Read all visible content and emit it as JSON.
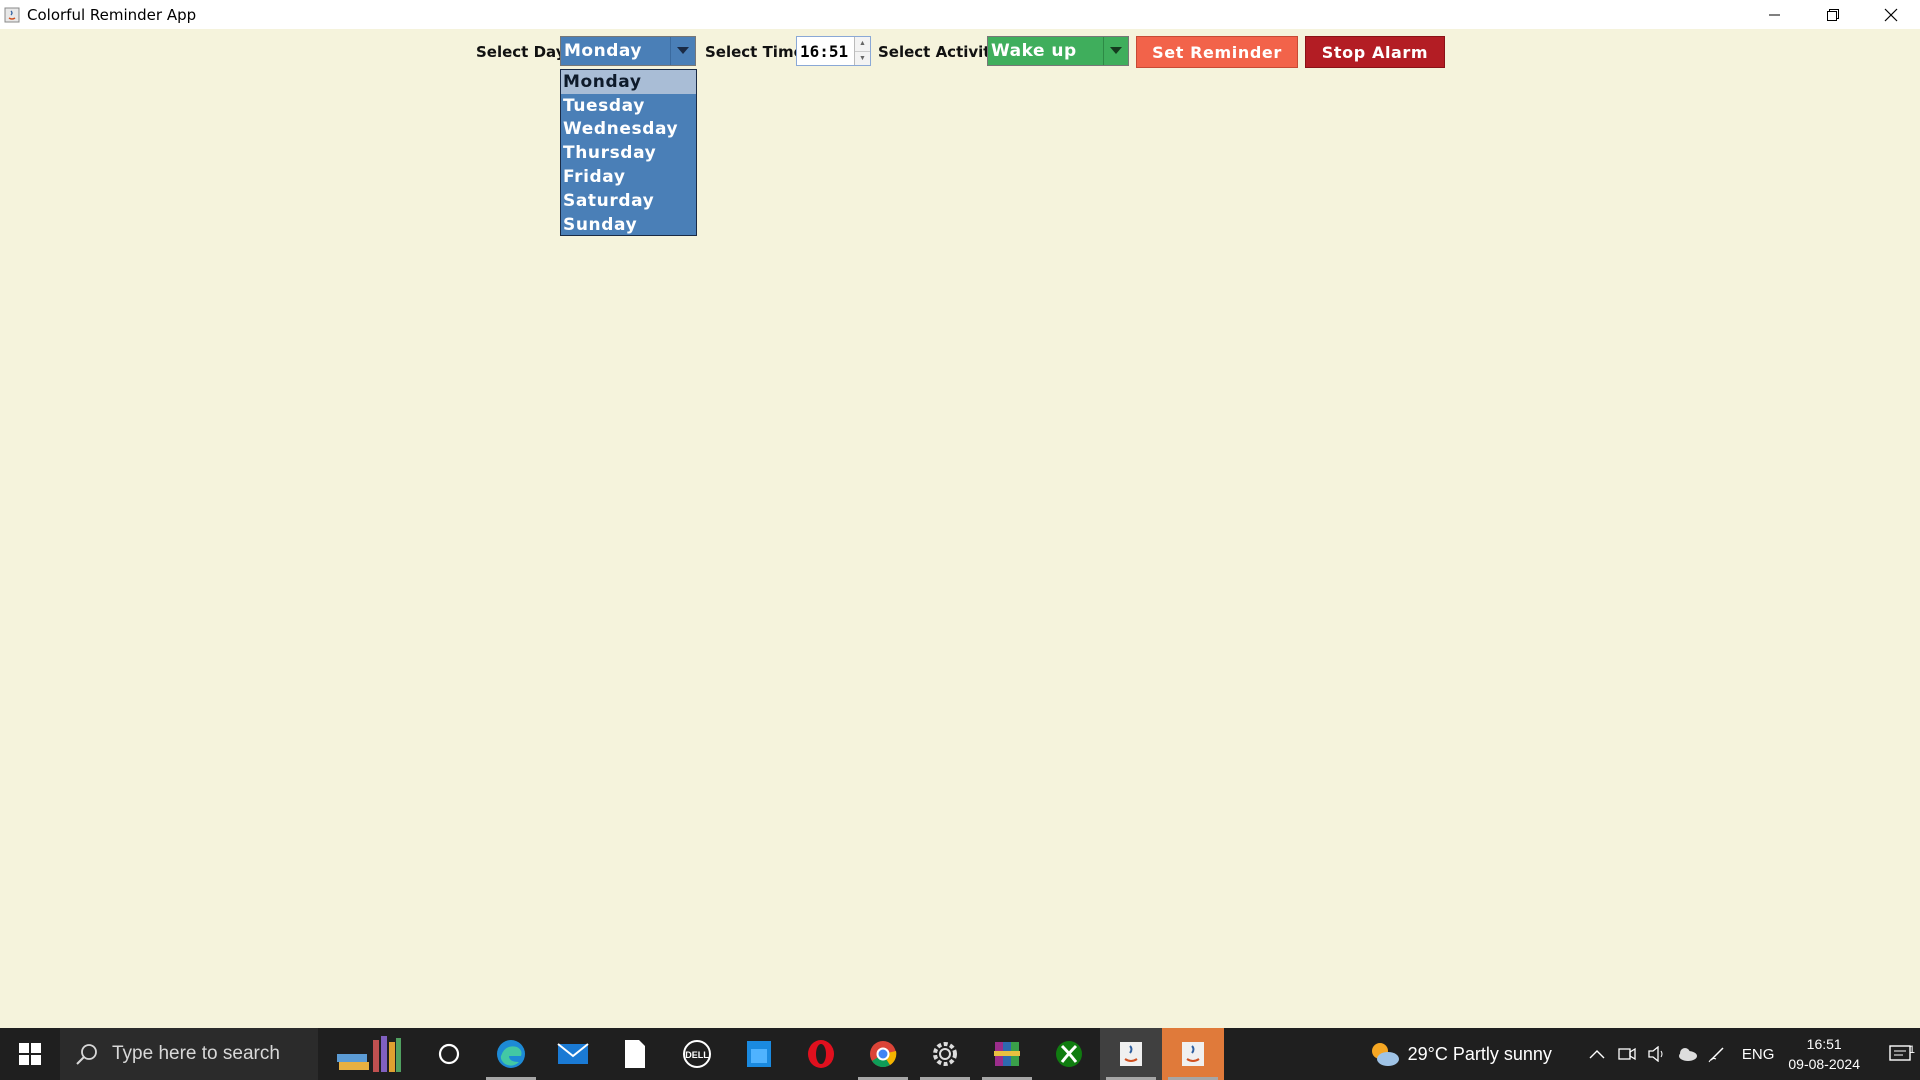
{
  "window": {
    "title": "Colorful Reminder App"
  },
  "controls": {
    "day_label": "Select Day:",
    "day_value": "Monday",
    "time_label": "Select Time:",
    "time_value": "16:51",
    "activity_label": "Select Activity:",
    "activity_value": "Wake up",
    "set_reminder_label": "Set Reminder",
    "stop_alarm_label": "Stop Alarm"
  },
  "day_dropdown": {
    "items": [
      "Monday",
      "Tuesday",
      "Wednesday",
      "Thursday",
      "Friday",
      "Saturday",
      "Sunday"
    ],
    "selected": "Monday"
  },
  "taskbar": {
    "search_placeholder": "Type here to search",
    "weather": "29°C  Partly sunny",
    "language": "ENG",
    "time": "16:51",
    "date": "09-08-2024",
    "notification_count": "1"
  },
  "colors": {
    "background": "#f5f3dc",
    "day_combo": "#4a7fb7",
    "activity_combo": "#3fae5c",
    "set_reminder": "#f2634a",
    "stop_alarm": "#b31d24"
  }
}
